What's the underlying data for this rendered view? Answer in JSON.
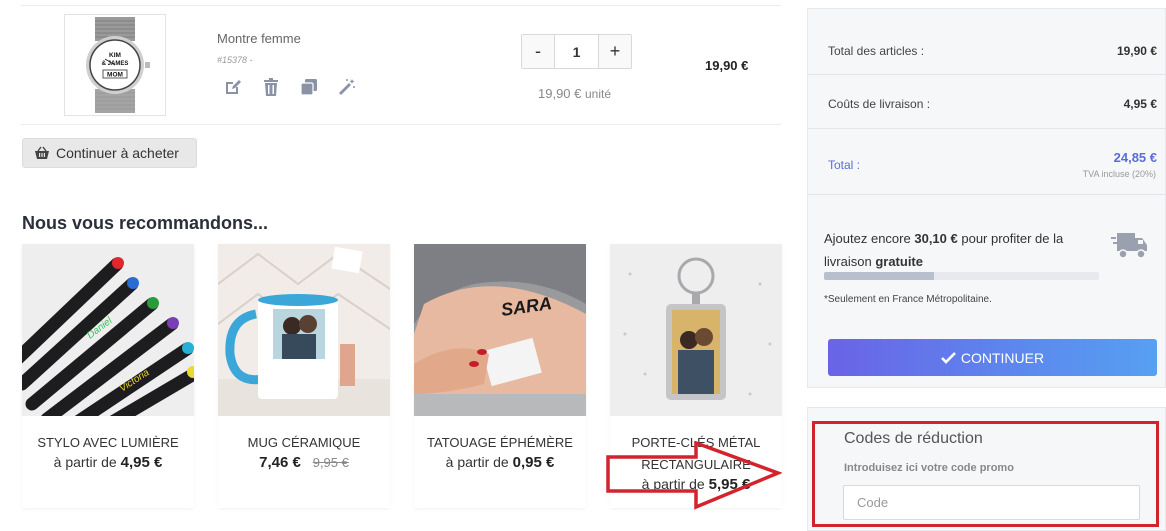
{
  "cart": {
    "item": {
      "name": "Montre femme",
      "ref": "#15378 -",
      "image_alt": "KIM & JAMES MOM watch",
      "watch_text_line1": "KIM",
      "watch_text_line2": "& JAMES",
      "watch_text_line3": "MOM",
      "quantity": "1",
      "minus_label": "-",
      "plus_label": "+",
      "unit_price": "19,90 €",
      "unit_label": "unité",
      "line_total": "19,90 €",
      "actions": [
        "edit-icon",
        "trash-icon",
        "duplicate-icon",
        "magic-wand-icon"
      ]
    },
    "continue_shopping_label": "Continuer à acheter"
  },
  "recommendations": {
    "title": "Nous vous recommandons...",
    "items": [
      {
        "name": "STYLO AVEC LUMIÈRE",
        "price_prefix": "à partir de",
        "price": "4,95 €"
      },
      {
        "name": "MUG CÉRAMIQUE",
        "price_prefix": "",
        "price": "7,46 €",
        "old_price": "9,95 €"
      },
      {
        "name": "TATOUAGE ÉPHÉMÈRE",
        "price_prefix": "à partir de",
        "price": "0,95 €"
      },
      {
        "name_line1": "PORTE-CLÉS MÉTAL",
        "name_line2": "RECTANGULAIRE",
        "price_prefix": "à partir de",
        "price": "5,95 €"
      }
    ],
    "pen_labels": [
      "Daniel",
      "Victoria"
    ],
    "tattoo_text": "SARA"
  },
  "summary": {
    "items_total_label": "Total des articles :",
    "items_total_value": "19,90 €",
    "shipping_label": "Coûts de livraison :",
    "shipping_value": "4,95 €",
    "total_label": "Total :",
    "total_value": "24,85 €",
    "tva_note": "TVA incluse (20%)",
    "free_shipping_before": "Ajoutez encore",
    "free_shipping_amount": "30,10 €",
    "free_shipping_middle": "pour profiter de la livraison",
    "free_shipping_word": "gratuite",
    "free_shipping_progress": 0.4,
    "metro_note": "*Seulement en France Métropolitaine.",
    "continue_label": "CONTINUER"
  },
  "discount": {
    "title": "Codes de réduction",
    "subtitle": "Introduisez ici votre code promo",
    "placeholder": "Code"
  },
  "colors": {
    "accent_total": "#5b6cd9",
    "cta_gradient_start": "#6a63e6",
    "cta_gradient_end": "#56a0f2",
    "annotation_red": "#d3242e"
  }
}
